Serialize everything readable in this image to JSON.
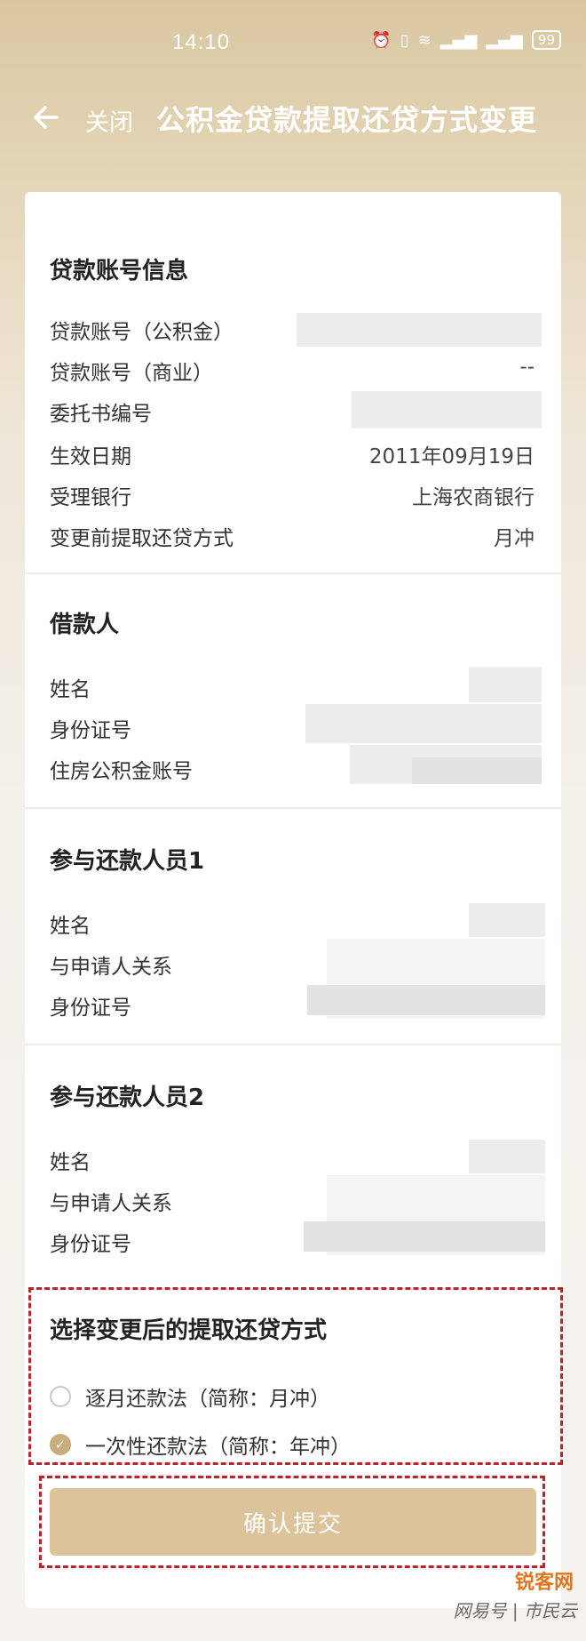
{
  "status_bar": {
    "time": "14:10",
    "icons": [
      "alarm-icon",
      "vibrate-icon",
      "wifi-icon",
      "signal-2g-icon",
      "signal-5g-icon"
    ],
    "battery": "99"
  },
  "header": {
    "back_icon": "arrow-left-icon",
    "close_label": "关闭",
    "title": "公积金贷款提取还贷方式变更"
  },
  "loan_info": {
    "title": "贷款账号信息",
    "rows": [
      {
        "label": "贷款账号（公积金）",
        "value": ""
      },
      {
        "label": "贷款账号（商业）",
        "value": "--"
      },
      {
        "label": "委托书编号",
        "value": ""
      },
      {
        "label": "生效日期",
        "value": "2011年09月19日"
      },
      {
        "label": "受理银行",
        "value": "上海农商银行"
      },
      {
        "label": "变更前提取还贷方式",
        "value": "月冲"
      }
    ]
  },
  "borrower": {
    "title": "借款人",
    "rows": [
      {
        "label": "姓名"
      },
      {
        "label": "身份证号"
      },
      {
        "label": "住房公积金账号"
      }
    ]
  },
  "repayer1": {
    "title": "参与还款人员1",
    "rows": [
      {
        "label": "姓名"
      },
      {
        "label": "与申请人关系"
      },
      {
        "label": "身份证号"
      }
    ]
  },
  "repayer2": {
    "title": "参与还款人员2",
    "rows": [
      {
        "label": "姓名"
      },
      {
        "label": "与申请人关系"
      },
      {
        "label": "身份证号"
      }
    ]
  },
  "method": {
    "title": "选择变更后的提取还贷方式",
    "options": [
      {
        "label": "逐月还款法（简称：月冲）",
        "checked": false
      },
      {
        "label": "一次性还款法（简称：年冲）",
        "checked": true
      }
    ]
  },
  "submit_label": "确认提交",
  "watermark": {
    "logo": "锐客网",
    "text": "网易号 | 市民云"
  },
  "colors": {
    "accent": "#c9ad7d",
    "header_bg": "#d9c7a1",
    "highlight_border": "#c1222a"
  }
}
